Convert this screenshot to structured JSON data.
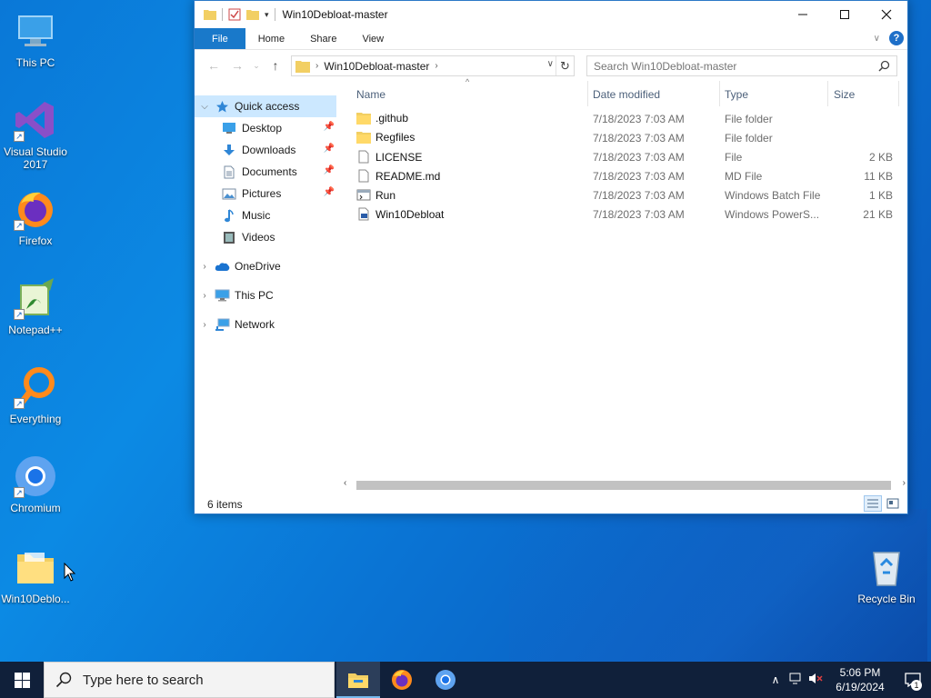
{
  "desktop": {
    "icons": [
      {
        "label": "This PC",
        "icon": "this-pc-icon"
      },
      {
        "label": "Visual Studio 2017",
        "icon": "visual-studio-icon"
      },
      {
        "label": "Firefox",
        "icon": "firefox-icon"
      },
      {
        "label": "Notepad++",
        "icon": "notepad-plus-plus-icon"
      },
      {
        "label": "Everything",
        "icon": "everything-search-icon"
      },
      {
        "label": "Chromium",
        "icon": "chromium-icon"
      },
      {
        "label": "Win10Deblo...",
        "icon": "folder-icon"
      },
      {
        "label": "Recycle Bin",
        "icon": "recycle-bin-icon"
      }
    ]
  },
  "window": {
    "title": "Win10Debloat-master",
    "ribbon_tabs": [
      "File",
      "Home",
      "Share",
      "View"
    ],
    "help_label": "?",
    "address": {
      "crumb": "Win10Debloat-master"
    },
    "search": {
      "placeholder": "Search Win10Debloat-master"
    },
    "nav": {
      "quick_access": "Quick access",
      "pinned": [
        {
          "label": "Desktop",
          "icon": "desktop-icon"
        },
        {
          "label": "Downloads",
          "icon": "downloads-icon"
        },
        {
          "label": "Documents",
          "icon": "documents-icon"
        },
        {
          "label": "Pictures",
          "icon": "pictures-icon"
        },
        {
          "label": "Music",
          "icon": "music-icon"
        },
        {
          "label": "Videos",
          "icon": "videos-icon"
        }
      ],
      "onedrive": "OneDrive",
      "this_pc": "This PC",
      "network": "Network"
    },
    "columns": {
      "name": "Name",
      "date": "Date modified",
      "type": "Type",
      "size": "Size"
    },
    "files": [
      {
        "name": ".github",
        "date": "7/18/2023 7:03 AM",
        "type": "File folder",
        "size": "",
        "icon": "folder-icon"
      },
      {
        "name": "Regfiles",
        "date": "7/18/2023 7:03 AM",
        "type": "File folder",
        "size": "",
        "icon": "folder-icon"
      },
      {
        "name": "LICENSE",
        "date": "7/18/2023 7:03 AM",
        "type": "File",
        "size": "2 KB",
        "icon": "file-icon"
      },
      {
        "name": "README.md",
        "date": "7/18/2023 7:03 AM",
        "type": "MD File",
        "size": "11 KB",
        "icon": "file-icon"
      },
      {
        "name": "Run",
        "date": "7/18/2023 7:03 AM",
        "type": "Windows Batch File",
        "size": "1 KB",
        "icon": "batch-file-icon"
      },
      {
        "name": "Win10Debloat",
        "date": "7/18/2023 7:03 AM",
        "type": "Windows PowerS...",
        "size": "21 KB",
        "icon": "powershell-script-icon"
      }
    ],
    "status": "6 items"
  },
  "taskbar": {
    "search_placeholder": "Type here to search",
    "clock_time": "5:06 PM",
    "clock_date": "6/19/2024",
    "notification_count": "1"
  },
  "colors": {
    "accent": "#1979ca",
    "selection": "#cce8ff",
    "taskbar": "#10203a"
  }
}
